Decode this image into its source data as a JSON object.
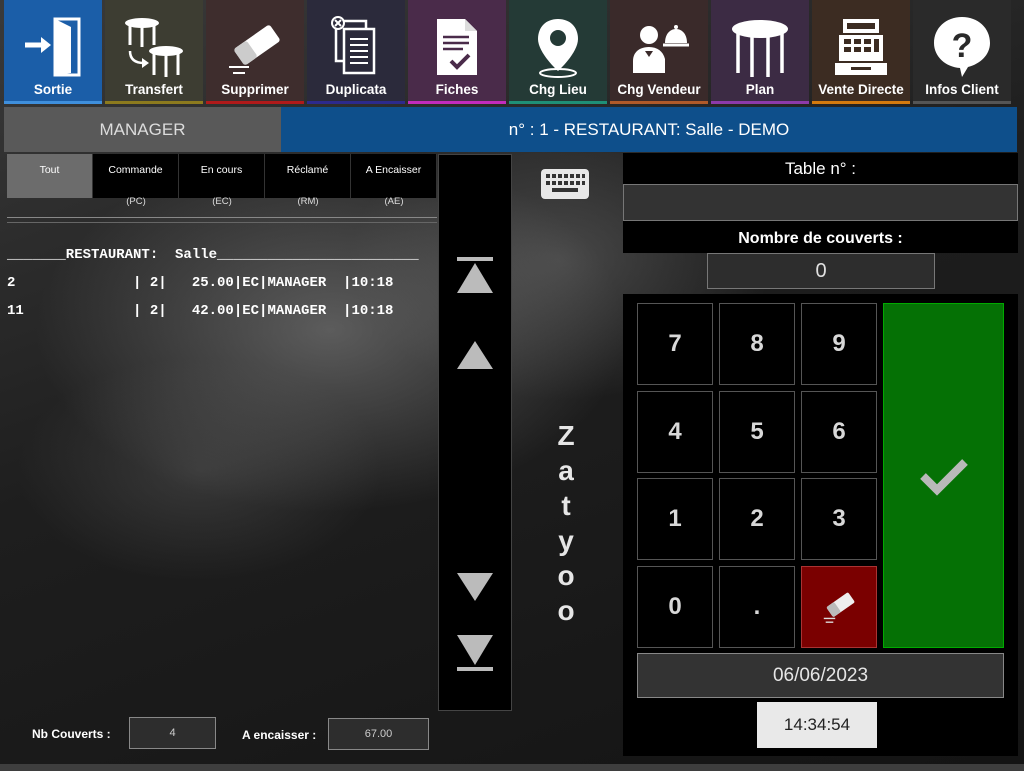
{
  "toolbar": {
    "buttons": [
      {
        "label": "Sortie",
        "icon": "exit-door-icon",
        "bg": "#1b5ea8",
        "accent": "#3f8fdc"
      },
      {
        "label": "Transfert",
        "icon": "table-transfer-icon",
        "bg": "#3d3d32",
        "accent": "#8c7a1e"
      },
      {
        "label": "Supprimer",
        "icon": "eraser-icon",
        "bg": "#3e2d2d",
        "accent": "#b01a1a"
      },
      {
        "label": "Duplicata",
        "icon": "duplicate-documents-icon",
        "bg": "#2b2a3b",
        "accent": "#2c2a8c"
      },
      {
        "label": "Fiches",
        "icon": "signed-document-icon",
        "bg": "#4a2b4a",
        "accent": "#c22bbd"
      },
      {
        "label": "Chg Lieu",
        "icon": "location-pin-icon",
        "bg": "#243a36",
        "accent": "#1f8f77"
      },
      {
        "label": "Chg Vendeur",
        "icon": "waiter-icon",
        "bg": "#3a2a2a",
        "accent": "#b05a2a"
      },
      {
        "label": "Plan",
        "icon": "round-table-icon",
        "bg": "#3c2b44",
        "accent": "#8c3aaa"
      },
      {
        "label": "Vente Directe",
        "icon": "cash-register-icon",
        "bg": "#3c2c22",
        "accent": "#d47a0e"
      },
      {
        "label": "Infos Client",
        "icon": "help-question-icon",
        "bg": "#2a2a2a",
        "accent": "#555555"
      }
    ]
  },
  "header": {
    "user": "MANAGER",
    "location": "n° : 1 - RESTAURANT: Salle - DEMO"
  },
  "filters": [
    {
      "label": "Tout",
      "code": ""
    },
    {
      "label": "Commande",
      "code": "(PC)"
    },
    {
      "label": "En cours",
      "code": "(EC)"
    },
    {
      "label": "Réclamé",
      "code": "(RM)"
    },
    {
      "label": "A Encaisser",
      "code": "(AE)"
    }
  ],
  "list": {
    "header": "_______RESTAURANT:  Salle________________________",
    "rows": [
      "2              | 2|   25.00|EC|MANAGER  |10:18",
      "11             | 2|   42.00|EC|MANAGER  |10:18"
    ]
  },
  "brand": [
    "Z",
    "a",
    "t",
    "y",
    "o",
    "o"
  ],
  "table_form": {
    "table_label": "Table n° :",
    "table_value": "",
    "covers_label": "Nombre de couverts :",
    "covers_value": "0"
  },
  "keypad": {
    "keys": [
      "7",
      "8",
      "9",
      "4",
      "5",
      "6",
      "1",
      "2",
      "3",
      "0",
      "."
    ],
    "erase_icon": "eraser-icon",
    "ok_icon": "checkmark-icon"
  },
  "datetime": {
    "date": "06/06/2023",
    "time": "14:34:54"
  },
  "footer": {
    "covers_label": "Nb Couverts :",
    "covers_value": "4",
    "due_label": "A encaisser :",
    "due_value": "67.00"
  },
  "colors": {
    "banner": "#0e4f8b",
    "ok": "#057105",
    "erase": "#7a0000"
  }
}
